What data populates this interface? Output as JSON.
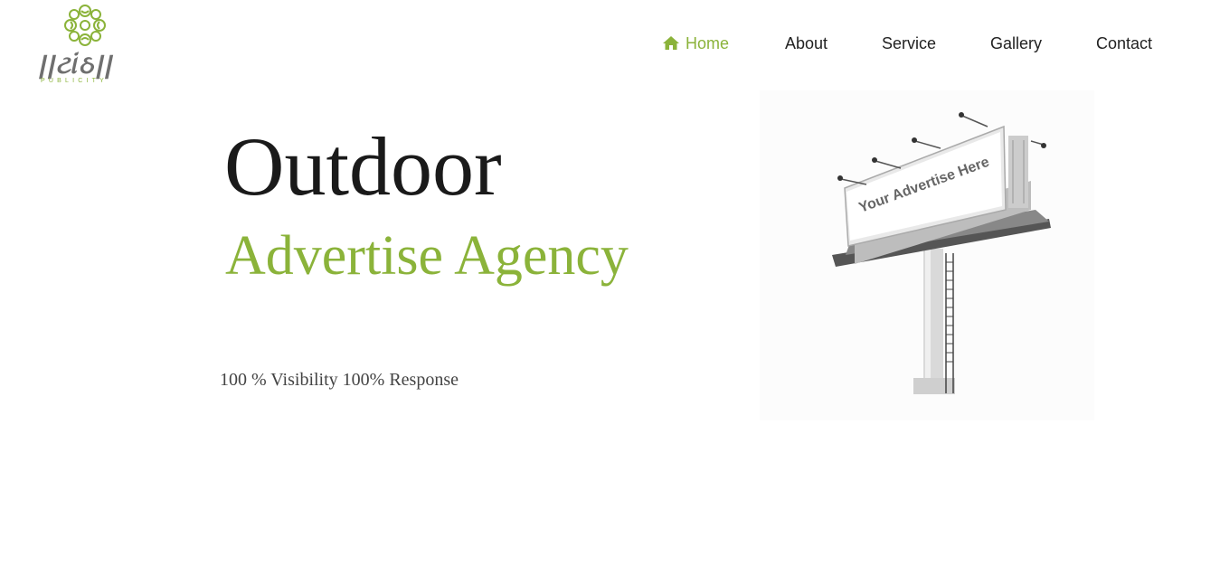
{
  "logo": {
    "wordmark": "||ટાંઠ||",
    "sub": "PUBLICITY"
  },
  "nav": {
    "items": [
      {
        "label": "Home",
        "icon": "home-icon",
        "active": true
      },
      {
        "label": "About"
      },
      {
        "label": "Service"
      },
      {
        "label": "Gallery"
      },
      {
        "label": "Contact"
      }
    ]
  },
  "hero": {
    "title": "Outdoor",
    "subtitle": "Advertise Agency",
    "tagline": "100 % Visibility 100% Response"
  },
  "billboard": {
    "text": "Your Advertise Here"
  },
  "colors": {
    "accent": "#8bb33a",
    "text": "#1a1a1a"
  }
}
